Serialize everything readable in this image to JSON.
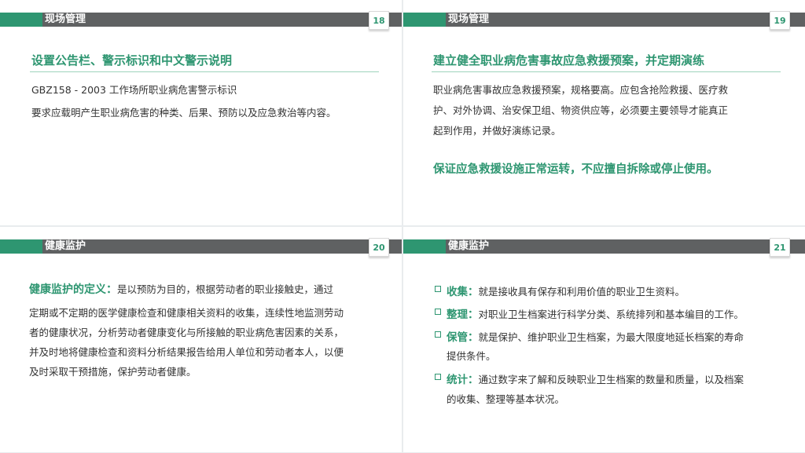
{
  "slides": [
    {
      "section": "现场管理",
      "page": "18",
      "heading": "设置公告栏、警示标识和中文警示说明",
      "lines": [
        "GBZ158 - 2003    工作场所职业病危害警示标识",
        "要求应载明产生职业病危害的种类、后果、预防以及应急救治等内容。"
      ]
    },
    {
      "section": "现场管理",
      "page": "19",
      "heading": "建立健全职业病危害事故应急救援预案，并定期演练",
      "lines": [
        "职业病危害事故应急救援预案，规格要高。应包含抢险救援、医疗救",
        "护、对外协调、治安保卫组、物资供应等，必须要主要领导才能真正",
        "起到作用，并做好演练记录。"
      ],
      "emphasis": "保证应急救援设施正常运转，不应擅自拆除或停止使用。"
    },
    {
      "section": "健康监护",
      "page": "20",
      "term": "健康监护的定义：",
      "lines": [
        "是以预防为目的，根据劳动者的职业接触史，通过",
        "定期或不定期的医学健康检查和健康相关资料的收集，连续性地监测劳动",
        "者的健康状况，分析劳动者健康变化与所接触的职业病危害因素的关系，",
        "并及时地将健康检查和资料分析结果报告给用人单位和劳动者本人，以便",
        "及时采取干预措施，保护劳动者健康。"
      ]
    },
    {
      "section": "健康监护",
      "page": "21",
      "items": [
        {
          "term": "收集：",
          "lines": [
            "就是接收具有保存和利用价值的职业卫生资料。"
          ]
        },
        {
          "term": "整理：",
          "lines": [
            "对职业卫生档案进行科学分类、系统排列和基本编目的工作。"
          ]
        },
        {
          "term": "保管：",
          "lines": [
            "就是保护、维护职业卫生档案，为最大限度地延长档案的寿命",
            "提供条件。"
          ]
        },
        {
          "term": "统计：",
          "lines": [
            "通过数字来了解和反映职业卫生档案的数量和质量，以及档案",
            "的收集、整理等基本状况。"
          ]
        }
      ]
    }
  ]
}
